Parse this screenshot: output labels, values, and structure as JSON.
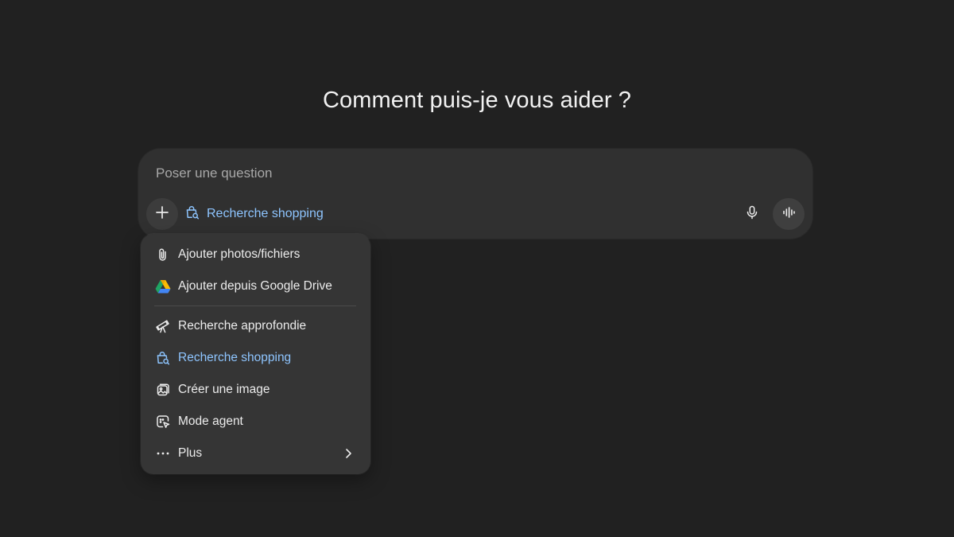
{
  "heading": "Comment puis-je vous aider ?",
  "composer": {
    "placeholder": "Poser une question",
    "active_tool": "Recherche shopping",
    "plus_icon": "plus-icon",
    "mic_icon": "microphone-icon",
    "voice_icon": "voice-waveform-icon"
  },
  "menu": {
    "items": [
      {
        "label": "Ajouter photos/fichiers",
        "icon": "paperclip-icon"
      },
      {
        "label": "Ajouter depuis Google Drive",
        "icon": "google-drive-icon"
      },
      {
        "label": "Recherche approfondie",
        "icon": "telescope-icon"
      },
      {
        "label": "Recherche shopping",
        "icon": "shopping-bag-search-icon",
        "active": true
      },
      {
        "label": "Créer une image",
        "icon": "image-icon"
      },
      {
        "label": "Mode agent",
        "icon": "agent-cursor-icon"
      },
      {
        "label": "Plus",
        "icon": "more-dots-icon",
        "has_submenu": true
      }
    ]
  },
  "colors": {
    "background": "#212121",
    "composer": "#303030",
    "menu": "#353535",
    "accent": "#8ec5ff",
    "text": "#ececec",
    "placeholder": "#a8a8a8"
  }
}
